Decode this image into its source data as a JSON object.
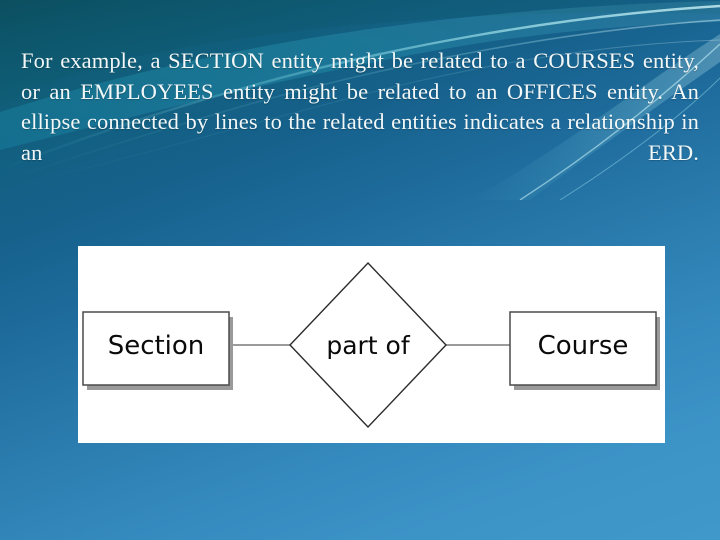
{
  "slide": {
    "background": {
      "top_color": "#0d5566",
      "mid_color": "#1f6d9e",
      "bottom_color": "#4098ca",
      "swirl_color": "#6fd8e6"
    },
    "body_text": "For example, a SECTION entity might be related to a COURSES entity, or an EMPLOYEES entity might be related to an OFFICES entity. An ellipse connected by lines to the related entities indicates a relationship in an ERD.",
    "text_color": "#f2f7f8"
  },
  "diagram": {
    "panel_background": "#ffffff",
    "stroke_color": "#3c3c3c",
    "shadow_color": "#9a9a9a",
    "entities": [
      {
        "id": "section",
        "label": "Section",
        "shape": "rectangle"
      },
      {
        "id": "course",
        "label": "Course",
        "shape": "rectangle"
      }
    ],
    "relationship": {
      "id": "part-of",
      "label": "part of",
      "shape": "diamond"
    },
    "connectors": [
      {
        "from": "section",
        "to": "part-of"
      },
      {
        "from": "part-of",
        "to": "course"
      }
    ]
  }
}
